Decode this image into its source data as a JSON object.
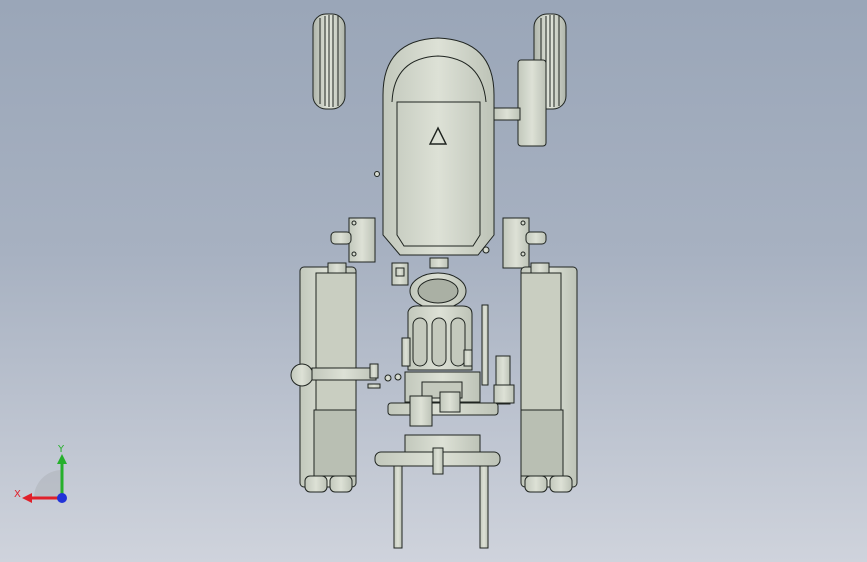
{
  "viewport": {
    "model_subject": "tractor-top-view",
    "background_top": "#9aa6b8",
    "background_bottom": "#cfd3dc",
    "part_fill": "#d5dace",
    "part_shade": "#b7bdb2",
    "edge_color": "#1f2420"
  },
  "triad": {
    "x_label": "X",
    "y_label": "Y",
    "x_color": "#e0202a",
    "y_color": "#26b02c",
    "z_color": "#2233d8"
  }
}
